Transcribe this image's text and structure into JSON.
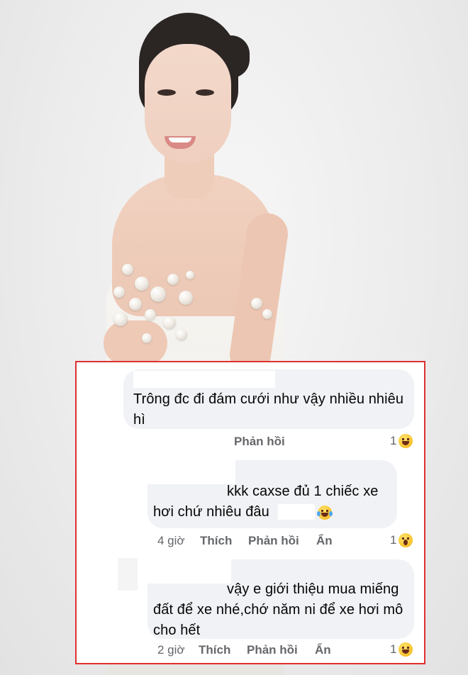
{
  "comments": [
    {
      "text": "Trông đc đi đám cưới như vậy nhiều nhiêu hì",
      "reply_label": "Phản hồi",
      "reaction_count": "1",
      "reaction_icon": "laughing-emoji-icon"
    },
    {
      "text": "kkk caxse đủ 1 chiếc xe hơi chứ nhiêu đâu",
      "inline_emoji": "tears-of-joy-emoji-icon",
      "time": "4 giờ",
      "like_label": "Thích",
      "reply_label": "Phản hồi",
      "hide_label": "Ẩn",
      "reaction_count": "1",
      "reaction_icon": "surprised-emoji-icon"
    },
    {
      "text": "vậy e giới thiệu mua miếng đất để xe nhé,chớ năm ni để xe hơi mô cho hết",
      "time": "2 giờ",
      "like_label": "Thích",
      "reply_label": "Phản hồi",
      "hide_label": "Ẩn",
      "reaction_count": "1",
      "reaction_icon": "laughing-emoji-icon"
    }
  ],
  "colors": {
    "panel_border": "#e03030",
    "bubble_bg": "#f0f2f5",
    "meta_text": "#65676b"
  }
}
